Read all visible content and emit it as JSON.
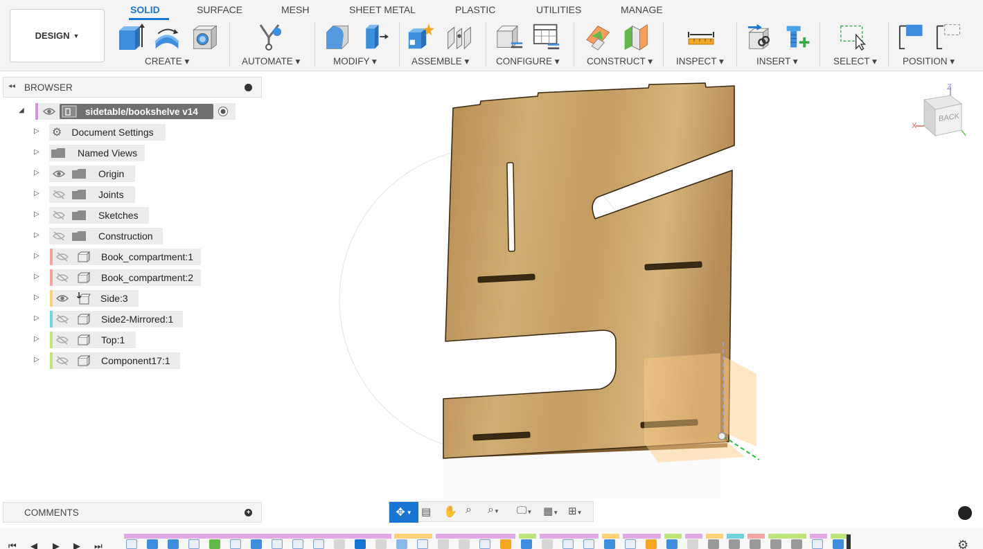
{
  "workspace": {
    "label": "DESIGN"
  },
  "tabs": [
    {
      "label": "SOLID",
      "active": true
    },
    {
      "label": "SURFACE"
    },
    {
      "label": "MESH"
    },
    {
      "label": "SHEET METAL"
    },
    {
      "label": "PLASTIC"
    },
    {
      "label": "UTILITIES"
    },
    {
      "label": "MANAGE"
    }
  ],
  "groups": [
    {
      "label": "CREATE",
      "icons": [
        "extrude-icon",
        "revolve-icon",
        "hole-icon"
      ]
    },
    {
      "label": "AUTOMATE",
      "icons": [
        "automate-icon"
      ]
    },
    {
      "label": "MODIFY",
      "icons": [
        "press-pull-icon",
        "fillet-icon"
      ]
    },
    {
      "label": "ASSEMBLE",
      "icons": [
        "new-component-icon",
        "joint-icon"
      ]
    },
    {
      "label": "CONFIGURE",
      "icons": [
        "configure-icon",
        "configure-table-icon"
      ]
    },
    {
      "label": "CONSTRUCT",
      "icons": [
        "offset-plane-icon",
        "midplane-icon"
      ]
    },
    {
      "label": "INSPECT",
      "icons": [
        "measure-icon"
      ]
    },
    {
      "label": "INSERT",
      "icons": [
        "insert-derive-icon",
        "insert-mcmaster-icon"
      ]
    },
    {
      "label": "SELECT",
      "icons": [
        "select-icon"
      ]
    },
    {
      "label": "POSITION",
      "icons": [
        "position-icon",
        "capture-position-icon"
      ]
    }
  ],
  "browser": {
    "title": "BROWSER",
    "root": "sidetable/bookshelve v14",
    "items": [
      {
        "label": "Document Settings",
        "icon": "gear-icon",
        "visible": null,
        "color": ""
      },
      {
        "label": "Named Views",
        "icon": "folder-icon",
        "visible": null,
        "color": ""
      },
      {
        "label": "Origin",
        "icon": "folder-icon",
        "visible": true,
        "color": ""
      },
      {
        "label": "Joints",
        "icon": "folder-icon",
        "visible": false,
        "color": ""
      },
      {
        "label": "Sketches",
        "icon": "folder-icon",
        "visible": false,
        "color": ""
      },
      {
        "label": "Construction",
        "icon": "folder-icon",
        "visible": false,
        "color": ""
      },
      {
        "label": "Book_compartment:1",
        "icon": "component-icon",
        "visible": false,
        "color": "#f4a3a3"
      },
      {
        "label": "Book_compartment:2",
        "icon": "component-icon",
        "visible": false,
        "color": "#f4a3a3"
      },
      {
        "label": "Side:3",
        "icon": "anchored-component-icon",
        "visible": true,
        "color": "#ffd27a"
      },
      {
        "label": "Side2-Mirrored:1",
        "icon": "component-icon",
        "visible": false,
        "color": "#6fd3e0"
      },
      {
        "label": "Top:1",
        "icon": "component-icon",
        "visible": false,
        "color": "#bde57a"
      },
      {
        "label": "Component17:1",
        "icon": "component-icon",
        "visible": false,
        "color": "#bde57a"
      }
    ]
  },
  "comments": {
    "title": "COMMENTS"
  },
  "viewcube": {
    "face": "BACK",
    "x": "X",
    "z": "Z"
  },
  "colors": {
    "accent": "#1a74d1",
    "wood": "#c9a46a",
    "root_marker": "#d98fe0"
  }
}
